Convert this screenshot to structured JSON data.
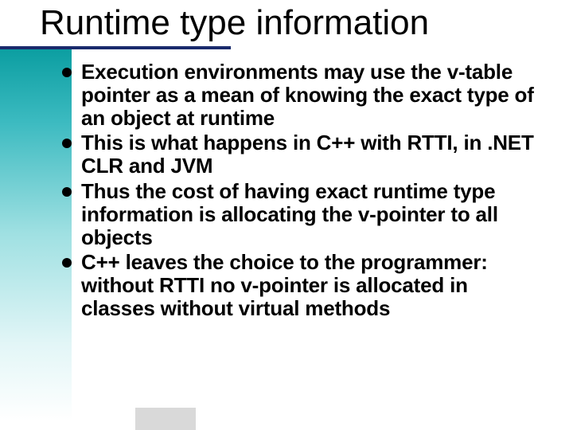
{
  "slide": {
    "title": "Runtime type information",
    "bullets": [
      "Execution environments may use the v-table pointer as a mean of knowing the exact type of an object at runtime",
      "This is what happens in C++ with RTTI, in .NET CLR and JVM",
      "Thus the cost of having exact runtime type information is allocating the v-pointer to all objects",
      "C++ leaves the choice to the programmer: without RTTI no v-pointer is allocated in classes without virtual methods"
    ]
  }
}
